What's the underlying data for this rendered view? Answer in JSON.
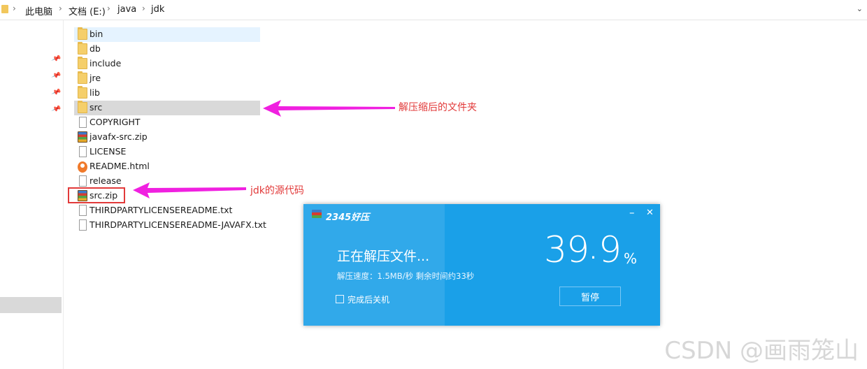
{
  "breadcrumb": {
    "items": [
      "此电脑",
      "文档 (E:)",
      "java",
      "jdk"
    ],
    "separator": "›"
  },
  "files": [
    {
      "name": "bin",
      "icon": "folder-icon"
    },
    {
      "name": "db",
      "icon": "folder-icon"
    },
    {
      "name": "include",
      "icon": "folder-icon"
    },
    {
      "name": "jre",
      "icon": "folder-icon"
    },
    {
      "name": "lib",
      "icon": "folder-icon"
    },
    {
      "name": "src",
      "icon": "folder-icon"
    },
    {
      "name": "COPYRIGHT",
      "icon": "file-icon"
    },
    {
      "name": "javafx-src.zip",
      "icon": "zip-icon"
    },
    {
      "name": "LICENSE",
      "icon": "file-icon"
    },
    {
      "name": "README.html",
      "icon": "html-icon"
    },
    {
      "name": "release",
      "icon": "file-icon"
    },
    {
      "name": "src.zip",
      "icon": "zip-icon"
    },
    {
      "name": "THIRDPARTYLICENSEREADME.txt",
      "icon": "text-file-icon"
    },
    {
      "name": "THIRDPARTYLICENSEREADME-JAVAFX.txt",
      "icon": "text-file-icon"
    }
  ],
  "annotations": {
    "src_folder_note": "解压缩后的文件夹",
    "src_zip_note": "jdk的源代码",
    "arrow_color": "#f020e0",
    "box_color": "#e23a3a"
  },
  "dialog": {
    "brand": "2345好压",
    "minimize": "–",
    "close": "✕",
    "status": "正在解压文件...",
    "speed": "解压速度：1.5MB/秒   剩余时间约33秒",
    "percent_int": "39",
    "percent_dot": ".",
    "percent_dec": "9",
    "percent_sign": "%",
    "shutdown_label": "完成后关机",
    "pause_label": "暂停",
    "accent": "#1aa0e8"
  },
  "watermark": "CSDN @画雨笼山"
}
